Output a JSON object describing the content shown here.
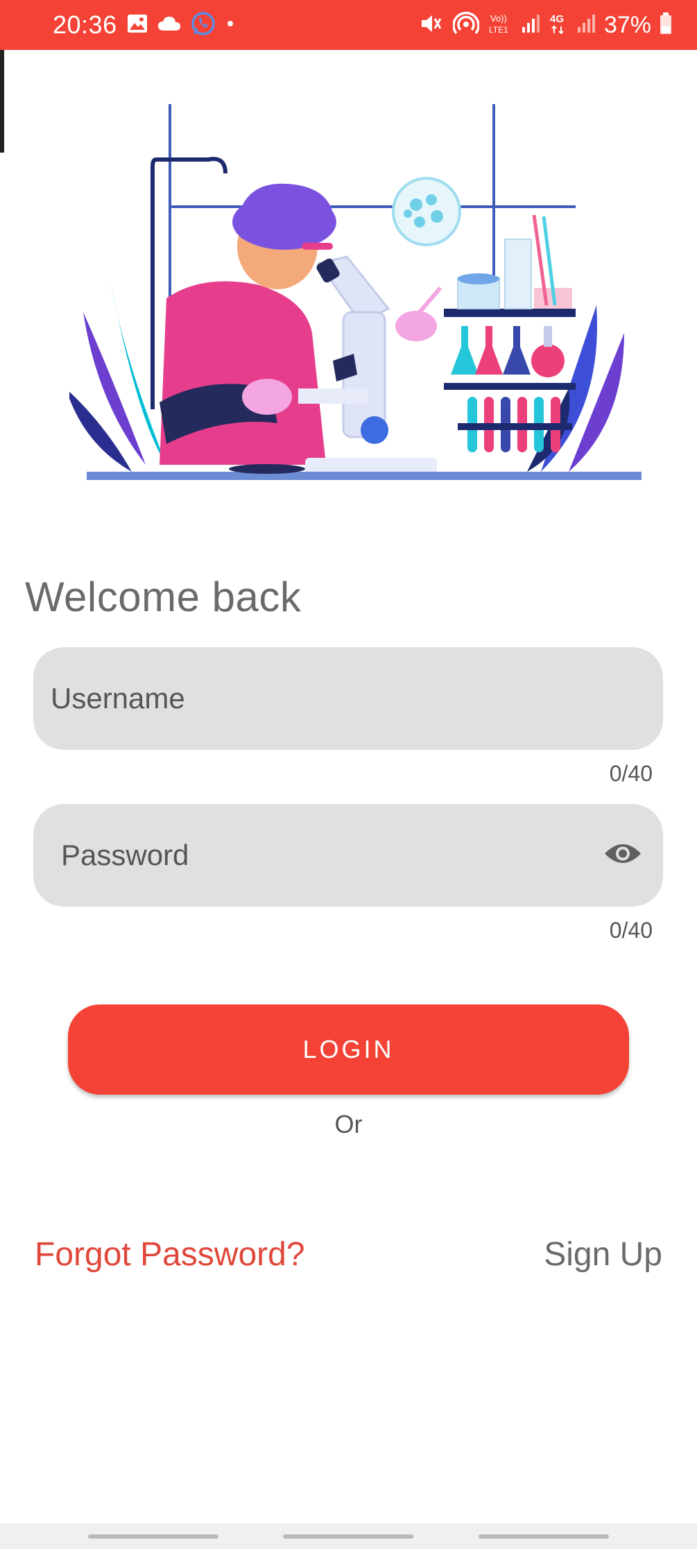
{
  "status_bar": {
    "time": "20:36",
    "battery": "37%",
    "icons": [
      "gallery-icon",
      "cloud-icon",
      "whatsapp-icon",
      "dot-icon",
      "mute-icon",
      "hotspot-icon",
      "volte-icon",
      "signal-icon",
      "4g-icon",
      "signal-icon",
      "battery-icon"
    ],
    "volte_label": "Vo)) LTE1",
    "network_label": "4G",
    "color": "#f44336"
  },
  "illustration": {
    "name": "scientist-microscope-illustration"
  },
  "login": {
    "welcome": "Welcome back",
    "username_placeholder": "Username",
    "username_counter": "0/40",
    "password_placeholder": "Password",
    "password_counter": "0/40",
    "login_label": "LOGIN",
    "or_label": "Or",
    "forgot_label": "Forgot Password?",
    "signup_label": "Sign Up"
  },
  "colors": {
    "accent": "#f44336",
    "field_bg": "#e0e0e0",
    "text_muted": "#6a6a6a"
  }
}
